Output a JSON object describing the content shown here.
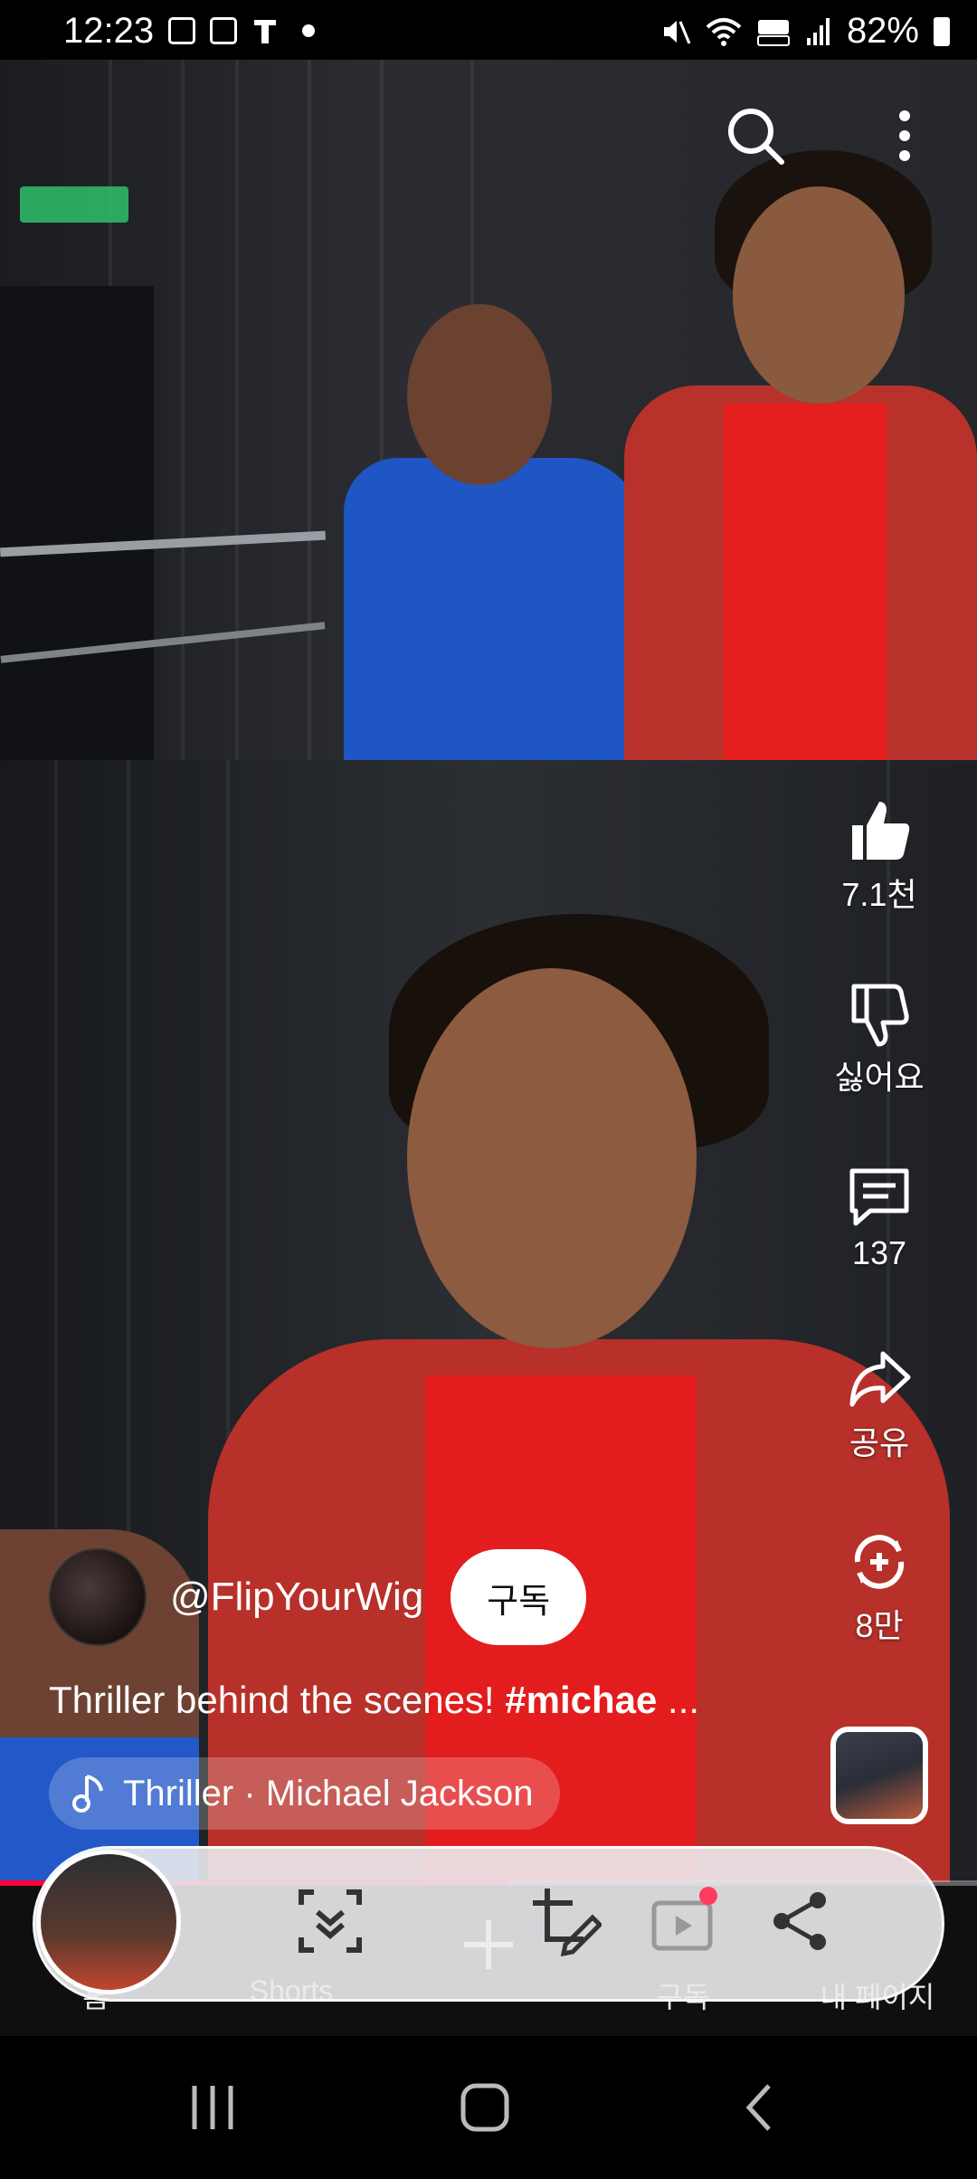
{
  "status_bar": {
    "time": "12:23",
    "battery": "82%",
    "icons": [
      "gallery-icon",
      "calendar-icon",
      "t-icon",
      "dot-icon",
      "mute-icon",
      "wifi-icon",
      "hd-voice-icon",
      "signal-icon",
      "battery-icon"
    ]
  },
  "top_controls": {
    "search_icon": "search-icon",
    "more_icon": "more-vertical-icon"
  },
  "actions": {
    "like_count": "7.1천",
    "dislike_label": "싫어요",
    "comment_count": "137",
    "share_label": "공유",
    "remix_count": "8만"
  },
  "video": {
    "channel_handle": "@FlipYourWig",
    "subscribe_label": "구독",
    "description_text": "Thriller behind the scenes! ",
    "description_tag": "#michae",
    "description_ellipsis": " ...",
    "music_label": "Thriller · Michael Jackson",
    "progress": 0.52
  },
  "bottom_nav": {
    "home_label": "홈",
    "shorts_label": "Shorts",
    "subscriptions_label": "구독",
    "my_page_label": "내 페이지"
  },
  "colors": {
    "accent": "#ff0033",
    "background": "#0f0f0f",
    "pill": "rgba(255,255,255,0.22)"
  }
}
